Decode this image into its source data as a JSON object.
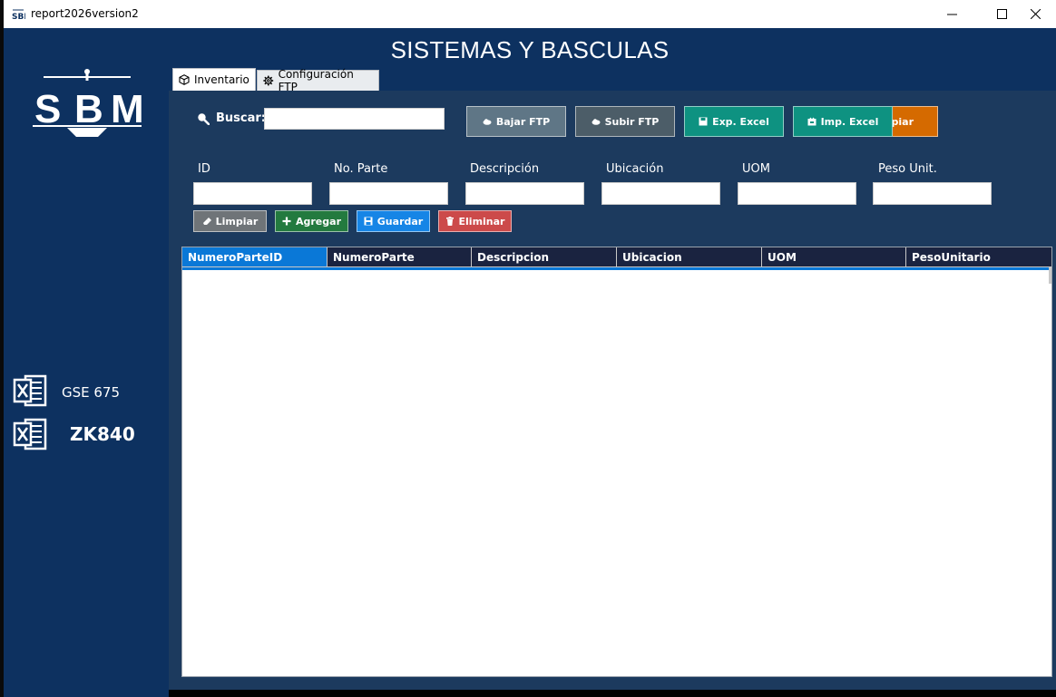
{
  "window": {
    "title": "report2026version2"
  },
  "header": {
    "title": "SISTEMAS Y BASCULAS"
  },
  "sidebar": {
    "logo_text": "SBM",
    "items": [
      {
        "label": "GSE 675",
        "icon": "excel-icon"
      },
      {
        "label": "ZK840",
        "icon": "excel-icon"
      }
    ]
  },
  "tabs": [
    {
      "label": "Inventario",
      "icon": "box-icon",
      "active": true
    },
    {
      "label": "Configuración FTP",
      "icon": "gear-icon",
      "active": false
    }
  ],
  "search": {
    "label": "Buscar:",
    "value": ""
  },
  "toolbar": {
    "download_ftp": "Bajar FTP",
    "upload_ftp": "Subir FTP",
    "export_excel": "Exp. Excel",
    "import_excel": "Imp. Excel",
    "overlapped": "piar"
  },
  "form": {
    "fields": [
      {
        "label": "ID",
        "value": ""
      },
      {
        "label": "No. Parte",
        "value": ""
      },
      {
        "label": "Descripción",
        "value": ""
      },
      {
        "label": "Ubicación",
        "value": ""
      },
      {
        "label": "UOM",
        "value": ""
      },
      {
        "label": "Peso Unit.",
        "value": ""
      }
    ],
    "buttons": {
      "clear": "Limpiar",
      "add": "Agregar",
      "save": "Guardar",
      "delete": "Eliminar"
    }
  },
  "grid": {
    "columns": [
      "NumeroParteID",
      "NumeroParte",
      "Descripcion",
      "Ubicacion",
      "UOM",
      "PesoUnitario"
    ],
    "rows": []
  },
  "colors": {
    "navy": "#0d3160",
    "panel": "#1c3a5e",
    "grid_header": "#1a2340",
    "btn_ftp_down": "#5f7686",
    "btn_ftp_up": "#4c5d68",
    "btn_excel": "#0e9281",
    "btn_orange": "#d56a00",
    "btn_clear": "#6f7478",
    "btn_add": "#237a3f",
    "btn_save": "#1685e6",
    "btn_delete": "#cc4a4a"
  }
}
